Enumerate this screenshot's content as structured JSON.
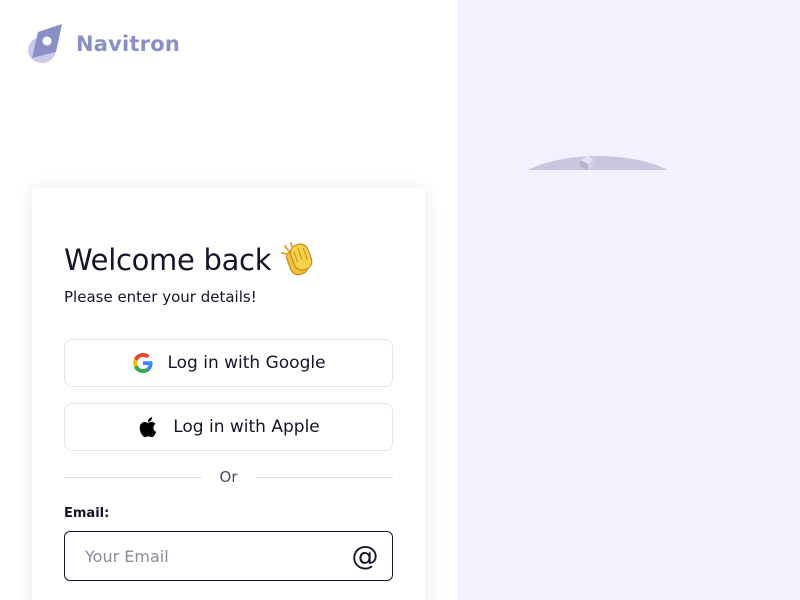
{
  "brand": {
    "name": "Navitron",
    "logo_icon": "navitron-logo-icon",
    "color": "#8a90c6"
  },
  "login": {
    "title": "Welcome back",
    "title_icon": "clapping-hands-icon",
    "subtitle": "Please enter your details!",
    "google_label": "Log in with Google",
    "google_icon": "google-icon",
    "apple_label": "Log in with Apple",
    "apple_icon": "apple-icon",
    "divider_text": "Or",
    "email_label": "Email:",
    "email_placeholder": "Your Email",
    "email_value": "",
    "email_icon": "at-sign-icon"
  },
  "colors": {
    "right_panel_bg": "#f2f1fd",
    "text": "#14142b",
    "border": "#e6e6ee"
  }
}
